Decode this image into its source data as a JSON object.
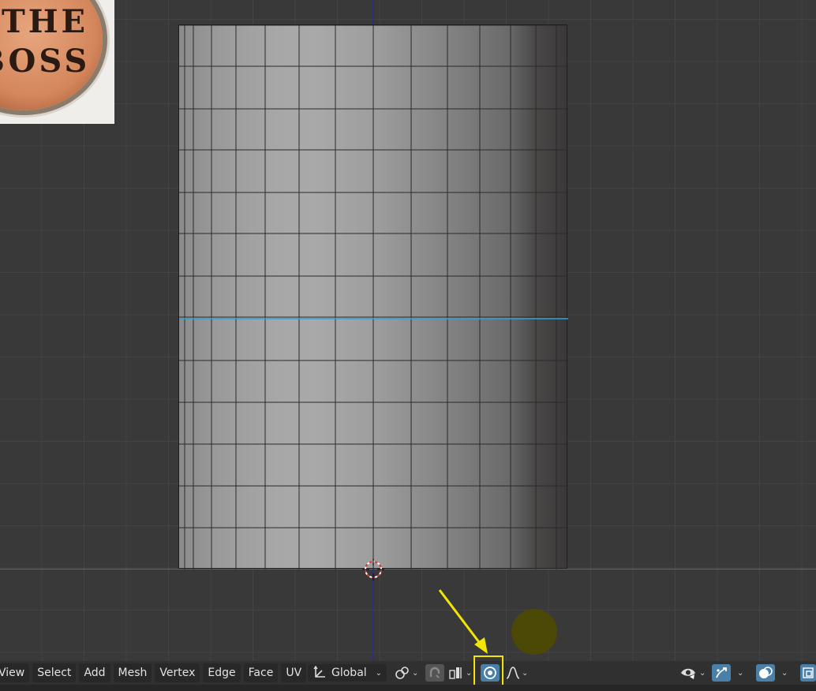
{
  "reference_image": {
    "text_line_1": "THE",
    "text_line_2": "BOSS"
  },
  "header": {
    "menu": [
      {
        "name": "menu-view",
        "label": "View"
      },
      {
        "name": "menu-select",
        "label": "Select"
      },
      {
        "name": "menu-add",
        "label": "Add"
      },
      {
        "name": "menu-mesh",
        "label": "Mesh"
      },
      {
        "name": "menu-vertex",
        "label": "Vertex"
      },
      {
        "name": "menu-edge",
        "label": "Edge"
      },
      {
        "name": "menu-face",
        "label": "Face"
      },
      {
        "name": "menu-uv",
        "label": "UV"
      }
    ],
    "transform_orientation": "Global",
    "icons": {
      "orientation": "transform-orientation-icon",
      "pivot": "pivot-point-icon",
      "snap": "snap-icon",
      "snap_target": "snap-target-icon",
      "proportional": "proportional-editing-icon",
      "falloff": "falloff-curve-icon",
      "visibility": "object-visibility-icon",
      "gizmo": "gizmo-icon",
      "overlays": "overlays-icon",
      "xray": "toggle-xray-icon"
    }
  },
  "colors": {
    "highlight": "#f2e600",
    "x_axis": "#4e7b2e",
    "z_axis": "#2b2f78",
    "loop_cut": "#2aa6d6",
    "active_toggle": "#4a7fa8"
  }
}
